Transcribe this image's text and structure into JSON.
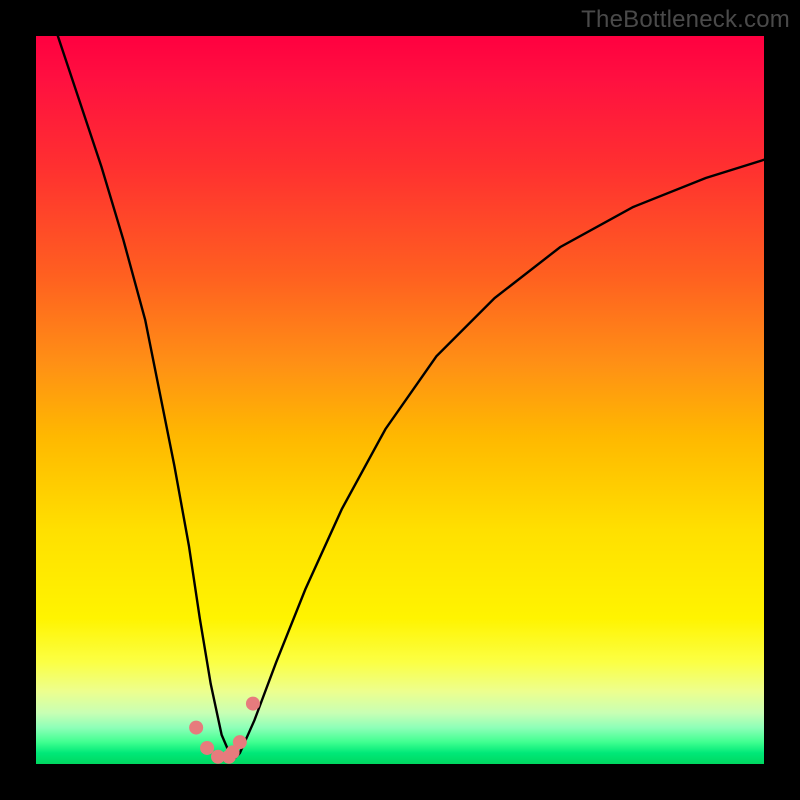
{
  "watermark": "TheBottleneck.com",
  "chart_data": {
    "type": "line",
    "title": "",
    "xlabel": "",
    "ylabel": "",
    "xlim": [
      0,
      100
    ],
    "ylim": [
      0,
      100
    ],
    "grid": false,
    "series": [
      {
        "name": "bottleneck-curve",
        "x": [
          0,
          3,
          6,
          9,
          12,
          15,
          17,
          19,
          21,
          22.5,
          24,
          25.5,
          27,
          28,
          30,
          33,
          37,
          42,
          48,
          55,
          63,
          72,
          82,
          92,
          100
        ],
        "y": [
          108,
          100,
          91,
          82,
          72,
          61,
          51,
          41,
          30,
          20,
          11,
          4,
          0.5,
          1.5,
          6,
          14,
          24,
          35,
          46,
          56,
          64,
          71,
          76.5,
          80.5,
          83
        ]
      }
    ],
    "markers": {
      "name": "highlight-dots",
      "color": "#e77b7d",
      "x": [
        22.0,
        23.5,
        25.0,
        26.5,
        27.0,
        28.0,
        29.8
      ],
      "y": [
        5.0,
        2.2,
        1.0,
        1.0,
        1.6,
        3.0,
        8.3
      ]
    },
    "gradient_stops": [
      {
        "pos": 0.0,
        "color": "#ff0040"
      },
      {
        "pos": 0.55,
        "color": "#ffb800"
      },
      {
        "pos": 0.8,
        "color": "#fff400"
      },
      {
        "pos": 1.0,
        "color": "#00d860"
      }
    ]
  }
}
